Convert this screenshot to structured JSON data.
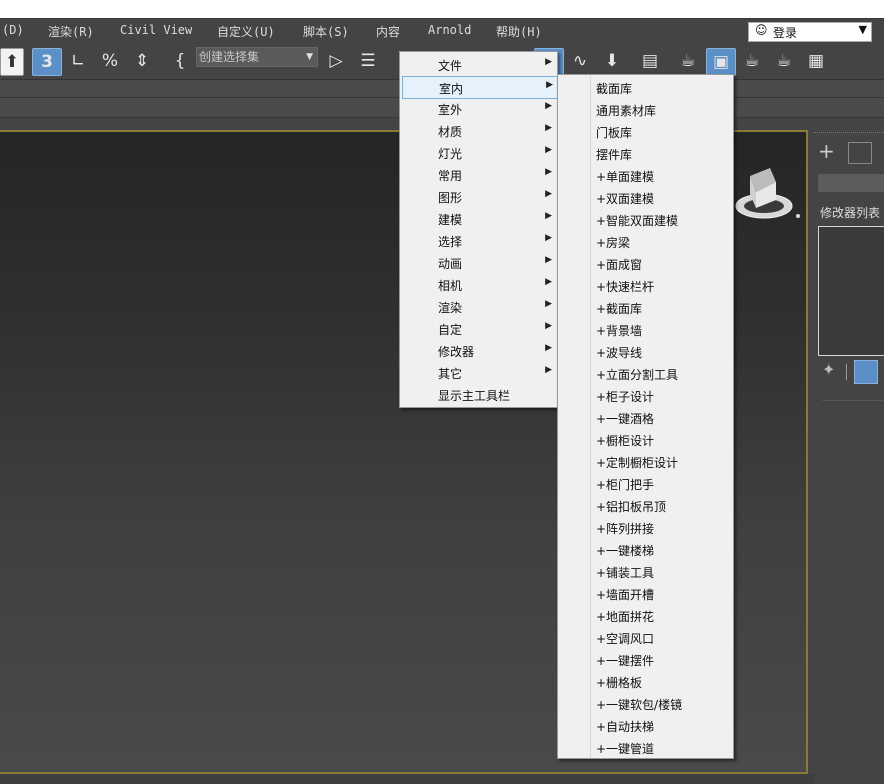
{
  "menubar": {
    "items": [
      "(D)",
      "渲染(R)",
      "Civil View",
      "自定义(U)",
      "脚本(S)",
      "内容",
      "Arnold",
      "帮助(H)"
    ],
    "login_label": "登录"
  },
  "toolbar": {
    "selection_set_placeholder": "创建选择集"
  },
  "side_panel": {
    "modifier_list_label": "修改器列表"
  },
  "menu_main": {
    "items": [
      "文件",
      "室内",
      "室外",
      "材质",
      "灯光",
      "常用",
      "图形",
      "建模",
      "选择",
      "动画",
      "相机",
      "渲染",
      "自定",
      "修改器",
      "其它",
      "显示主工具栏"
    ],
    "active_index": 1
  },
  "menu_sub": {
    "items": [
      "截面库",
      "通用素材库",
      "门板库",
      "摆件库",
      "+单面建模",
      "+双面建模",
      "+智能双面建模",
      "+房梁",
      "+面成窗",
      "+快速栏杆",
      "+截面库",
      "+背景墙",
      "+波导线",
      "+立面分割工具",
      "+柜子设计",
      "+一键酒格",
      "+橱柜设计",
      "+定制橱柜设计",
      "+柜门把手",
      "+铝扣板吊顶",
      "+阵列拼接",
      "+一键楼梯",
      "+铺装工具",
      "+墙面开槽",
      "+地面拼花",
      "+空调风口",
      "+一键摆件",
      "+栅格板",
      "+一键软包/楼镜",
      "+自动扶梯",
      "+一键管道"
    ]
  },
  "colors": {
    "accent_blue": "#5a8fc8",
    "viewport_border": "#8a7a3a",
    "menu_bg": "#f0f0f0",
    "menu_active_bg": "#e5f1fb"
  }
}
